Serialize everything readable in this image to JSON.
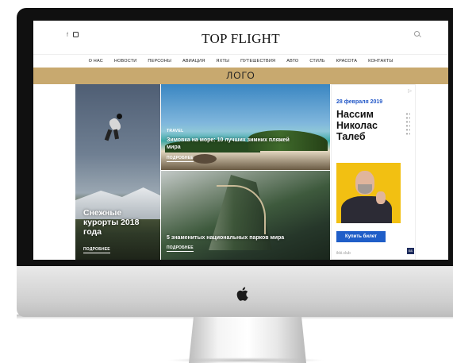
{
  "site": {
    "brand": "TOP FLIGHT",
    "social": {
      "facebook_glyph": "f"
    }
  },
  "nav": [
    "О НАС",
    "НОВОСТИ",
    "ПЕРСОНЫ",
    "АВИАЦИЯ",
    "ЯХТЫ",
    "ПУТЕШЕСТВИЯ",
    "АВТО",
    "СТИЛЬ",
    "КРАСОТА",
    "КОНТАКТЫ"
  ],
  "logo_band": {
    "text": "ЛОГО",
    "color": "#c8a96f"
  },
  "cards": {
    "ski": {
      "title_line1": "Снежные",
      "title_line2": "курорты 2018",
      "title_line3": "года",
      "more": "ПОДРОБНЕЕ"
    },
    "beach": {
      "tag": "TRAVEL",
      "title_line1": "Зимовка на море: 10 лучших зимних пляжей",
      "title_line2": "мира",
      "more": "ПОДРОБНЕЕ"
    },
    "park": {
      "title": "5 знаменитых национальных парков мира",
      "more": "ПОДРОБНЕЕ"
    }
  },
  "ad": {
    "mark": "▷",
    "date": "28 февраля 2019",
    "name_line1": "Нассим",
    "name_line2": "Николас",
    "name_line3": "Талеб",
    "button": "Купить билет",
    "footer": "ikki.club",
    "corner": "ББ",
    "accent": "#1f5ec8",
    "photo_bg": "#f2c012"
  }
}
